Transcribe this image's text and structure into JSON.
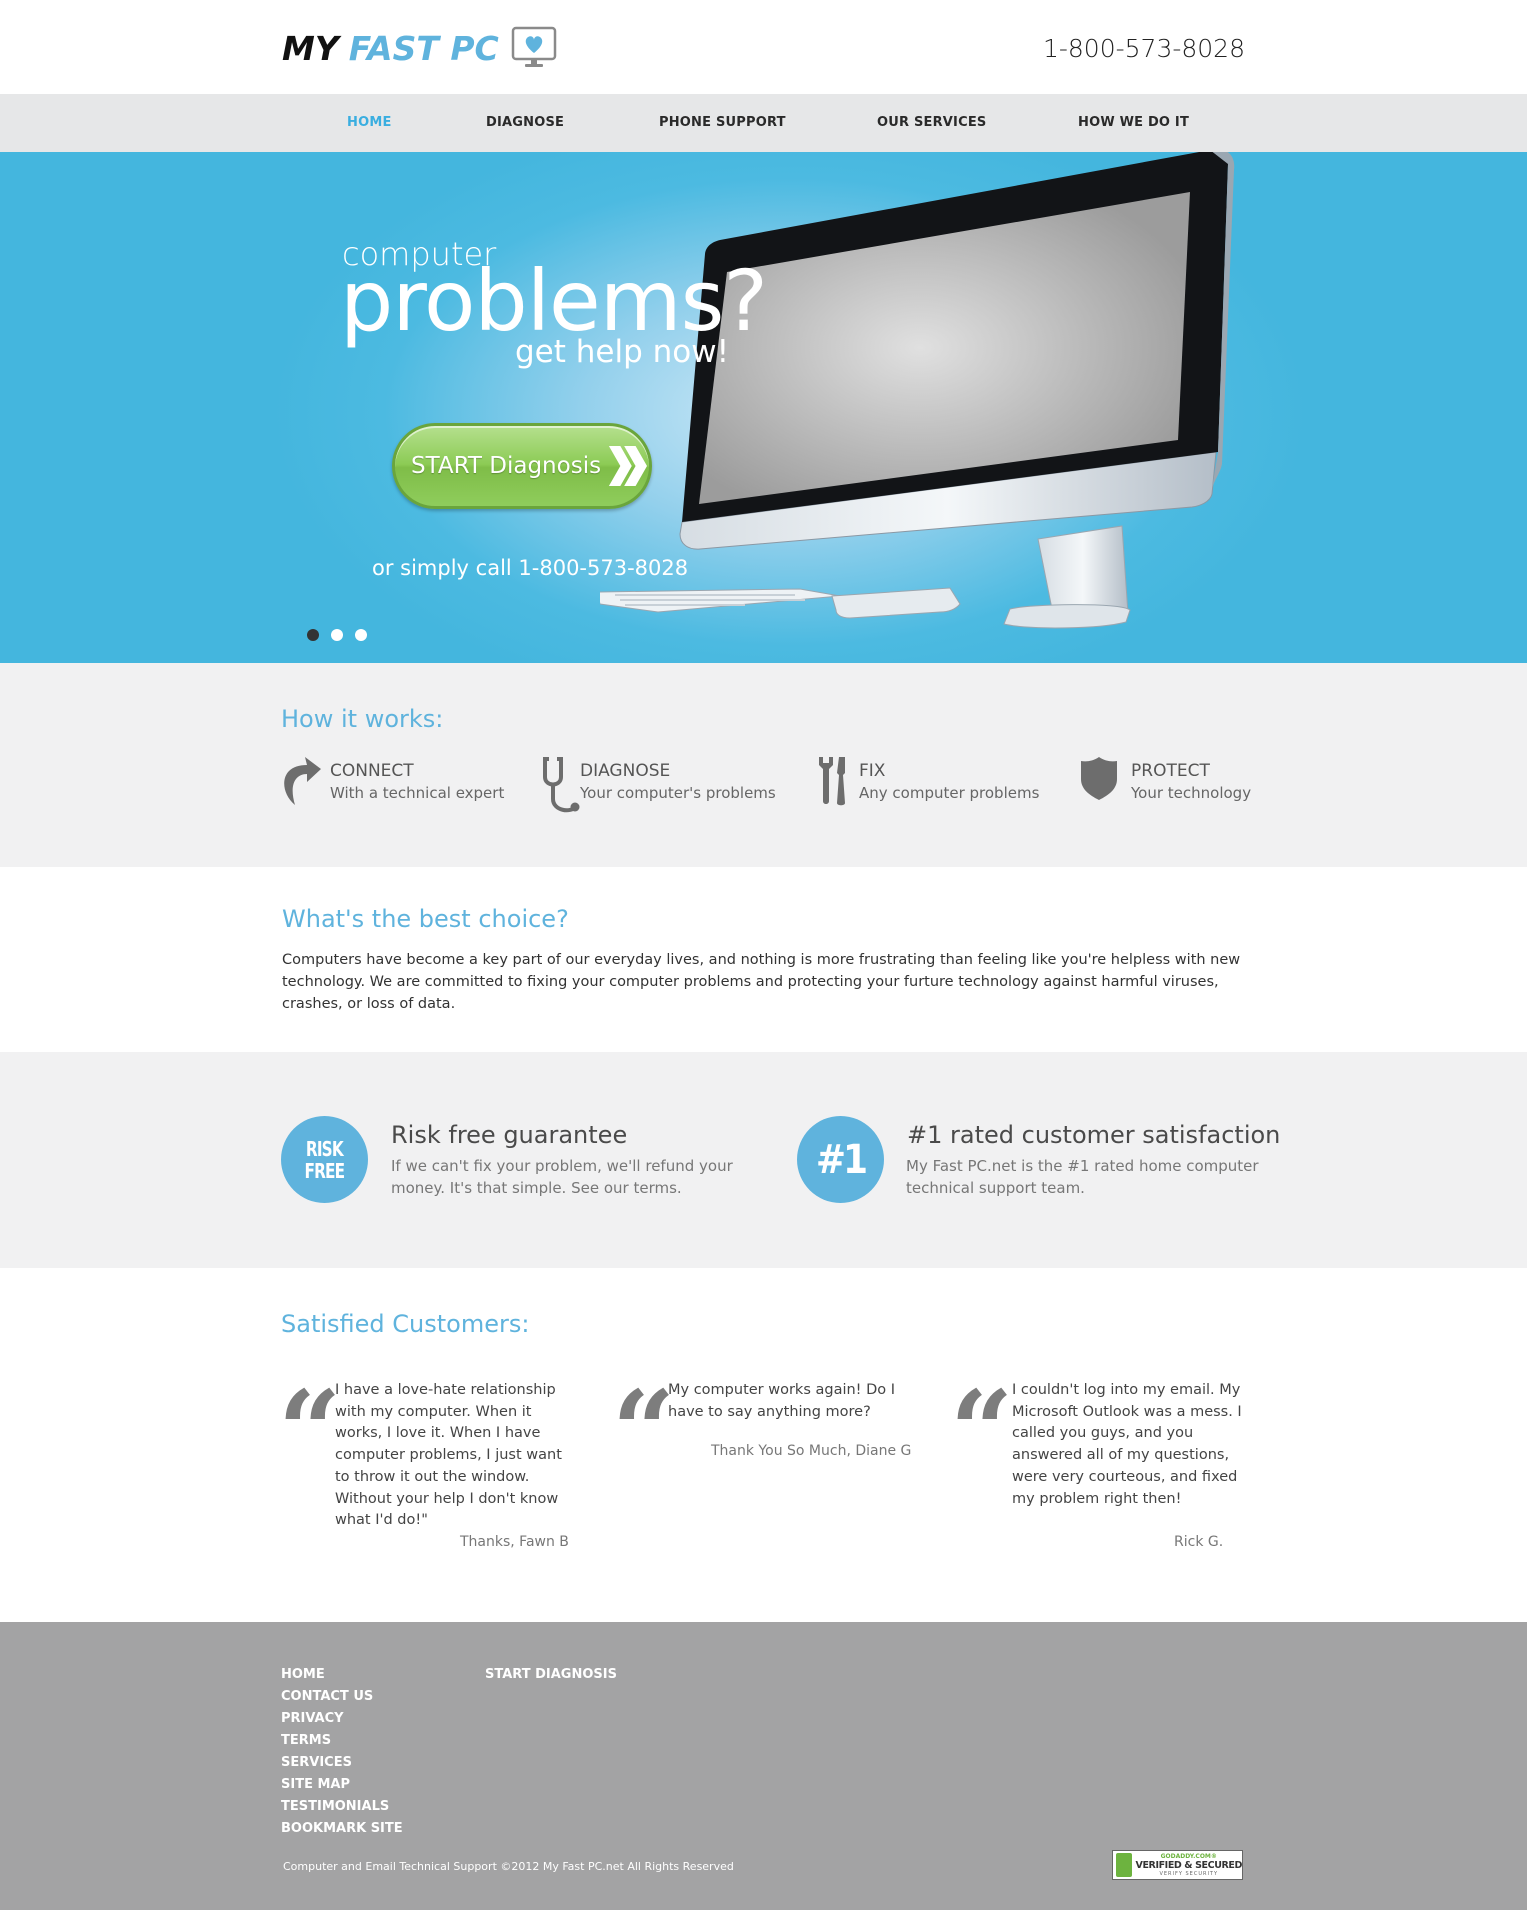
{
  "header": {
    "logo_my": "MY",
    "logo_fast": "FAST PC",
    "phone": "1-800-573-8028"
  },
  "nav": {
    "items": [
      "HOME",
      "DIAGNOSE",
      "PHONE SUPPORT",
      "OUR SERVICES",
      "HOW WE DO IT"
    ],
    "active": "HOME"
  },
  "hero": {
    "line1": "computer",
    "line2": "problems?",
    "line3": "get help now!",
    "cta_label": "START Diagnosis",
    "call_text": "or simply call 1-800-573-8028",
    "slides": 3,
    "active_slide": 1
  },
  "how": {
    "title": "How it works:",
    "steps": [
      {
        "title": "CONNECT",
        "sub": "With a technical expert",
        "icon": "curved-arrow-icon"
      },
      {
        "title": "DIAGNOSE",
        "sub": "Your computer's problems",
        "icon": "stethoscope-icon"
      },
      {
        "title": "FIX",
        "sub": "Any computer problems",
        "icon": "tools-icon"
      },
      {
        "title": "PROTECT",
        "sub": "Your technology",
        "icon": "shield-icon"
      }
    ]
  },
  "best": {
    "title": "What's the best choice?",
    "text": "Computers have become a key part of our everyday lives, and nothing is more frustrating than feeling like you're helpless with new technology. We are committed to fixing your computer problems and protecting your furture technology against harmful viruses, crashes, or loss of data."
  },
  "guarantees": [
    {
      "badge_line1": "RISK",
      "badge_line2": "FREE",
      "title": "Risk free guarantee",
      "text": "If we can't fix your problem, we'll refund your money. It's that simple. See our terms."
    },
    {
      "badge": "#1",
      "title": "#1 rated customer satisfaction",
      "text": "My Fast PC.net is the #1 rated home computer technical support team."
    }
  ],
  "testimonials": {
    "title": "Satisfied Customers:",
    "items": [
      {
        "text": "I have a love-hate relationship with my computer. When it works, I love it. When I have computer problems, I just want to throw it out the window. Without your help I don't know what I'd do!\"",
        "signature": "Thanks, Fawn B"
      },
      {
        "text": "My computer works again! Do I have to say anything more?",
        "signature": "Thank You So Much, Diane G"
      },
      {
        "text": "I couldn't log into my email. My Microsoft Outlook was a mess. I called you guys, and you answered all of my questions, were very courteous, and fixed my problem right then!",
        "signature": "Rick G."
      }
    ]
  },
  "footer": {
    "col1": [
      "HOME",
      "CONTACT US",
      "PRIVACY",
      "TERMS",
      "SERVICES",
      "SITE MAP",
      "TESTIMONIALS",
      "BOOKMARK SITE"
    ],
    "col2": [
      "START DIAGNOSIS"
    ],
    "copyright": "Computer and Email Technical Support ©2012 My Fast PC.net All Rights Reserved",
    "seal": {
      "top": "GODADDY.COM®",
      "main": "VERIFIED & SECURED",
      "bottom": "VERIFY SECURITY"
    }
  },
  "colors": {
    "accent": "#5fb3dd",
    "nav_active": "#3aaee0",
    "cta_green": "#8ccb55",
    "footer_bg": "#a3a3a4",
    "light_bg": "#f1f1f2"
  }
}
